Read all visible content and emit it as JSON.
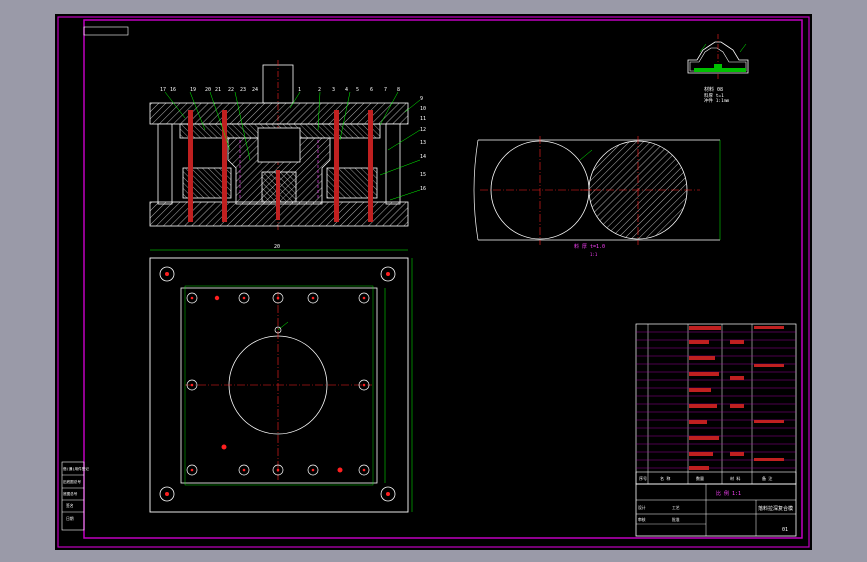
{
  "colors": {
    "background": "#9a9aa8",
    "sheet": "#000000",
    "border": "#c000c0",
    "line": "#ffffff",
    "centerline": "#ff2020",
    "leader": "#00ff00",
    "hidden": "#ff40ff",
    "text": "#ffffff"
  },
  "section_view": {
    "part_numbers_left": [
      "17",
      "16",
      "19",
      "20",
      "21",
      "22",
      "23",
      "24"
    ],
    "part_numbers_top": [
      "1",
      "2",
      "3",
      "4",
      "5",
      "6",
      "7",
      "8"
    ],
    "part_numbers_right": [
      "9",
      "10",
      "11",
      "12",
      "13",
      "14",
      "15",
      "16"
    ]
  },
  "plan_view": {
    "dimension_label": "20"
  },
  "blank_view": {
    "caption": "料 厚 t=1.0",
    "scale_note": "1:1"
  },
  "product_view": {
    "note_1": "材料 08",
    "note_2": "料厚 t=1",
    "note_3": "冲件 1:1mm"
  },
  "bom": {
    "header": [
      "序号",
      "名 称",
      "数量",
      "材 料",
      "备 注"
    ]
  },
  "title_block": {
    "drawing_name": "落料拉深复合模",
    "sheet_no": "01",
    "scale_label": "比 例 1:1",
    "row_labels": [
      "设计",
      "审核",
      "工艺",
      "批准"
    ]
  },
  "side_stamp": {
    "rows": [
      "借(通)用件登记",
      "旧底图总号",
      "底图总号",
      "签名",
      "日期"
    ]
  }
}
